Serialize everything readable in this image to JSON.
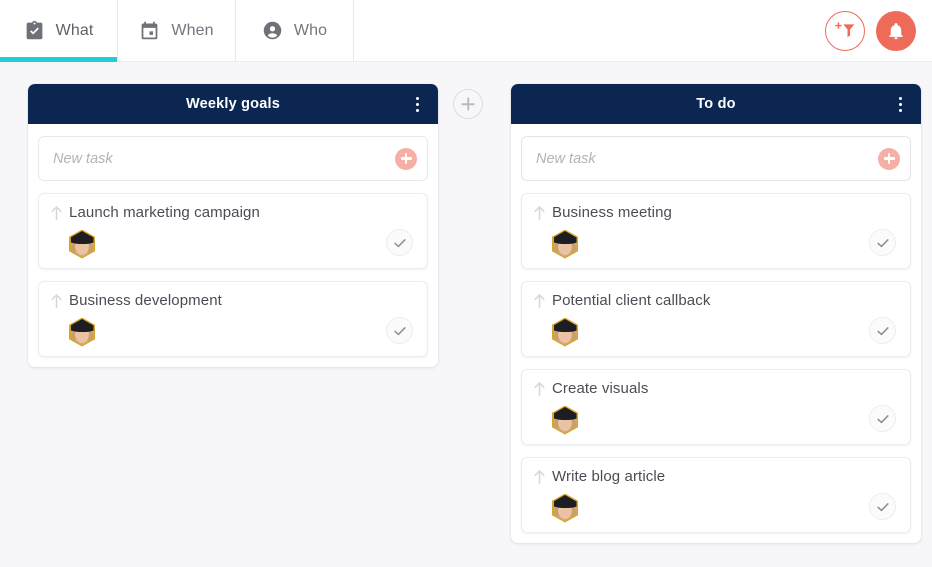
{
  "header": {
    "tabs": [
      {
        "label": "What",
        "icon": "clipboard-check-icon",
        "active": true
      },
      {
        "label": "When",
        "icon": "calendar-icon",
        "active": false
      },
      {
        "label": "Who",
        "icon": "person-icon",
        "active": false
      }
    ],
    "actions": [
      {
        "name": "add-filter-button",
        "icon": "add-filter-icon"
      },
      {
        "name": "notifications-button",
        "icon": "bell-icon"
      }
    ],
    "accent_color": "#22cdd6",
    "action_color": "#ee6b59"
  },
  "board": {
    "add_column_label": "+",
    "columns": [
      {
        "title": "Weekly goals",
        "menu_icon": "more-vertical-icon",
        "new_task": {
          "placeholder": "New task",
          "value": "",
          "focused": false,
          "add_icon": "plus-icon"
        },
        "cards": [
          {
            "title": "Launch marketing campaign",
            "priority_icon": "arrow-up-icon",
            "assignee_avatar": "user-avatar",
            "complete_icon": "check-icon"
          },
          {
            "title": "Business development",
            "priority_icon": "arrow-up-icon",
            "assignee_avatar": "user-avatar",
            "complete_icon": "check-icon"
          }
        ]
      },
      {
        "title": "To do",
        "menu_icon": "more-vertical-icon",
        "new_task": {
          "placeholder": "New task",
          "value": "",
          "focused": true,
          "add_icon": "plus-icon"
        },
        "cards": [
          {
            "title": "Business meeting",
            "priority_icon": "arrow-up-icon",
            "assignee_avatar": "user-avatar",
            "complete_icon": "check-icon"
          },
          {
            "title": "Potential client callback",
            "priority_icon": "arrow-up-icon",
            "assignee_avatar": "user-avatar",
            "complete_icon": "check-icon"
          },
          {
            "title": "Create visuals",
            "priority_icon": "arrow-up-icon",
            "assignee_avatar": "user-avatar",
            "complete_icon": "check-icon"
          },
          {
            "title": "Write blog article",
            "priority_icon": "arrow-up-icon",
            "assignee_avatar": "user-avatar",
            "complete_icon": "check-icon"
          }
        ]
      }
    ],
    "header_color": "#0a2651",
    "background_color": "#f7f7f9"
  }
}
